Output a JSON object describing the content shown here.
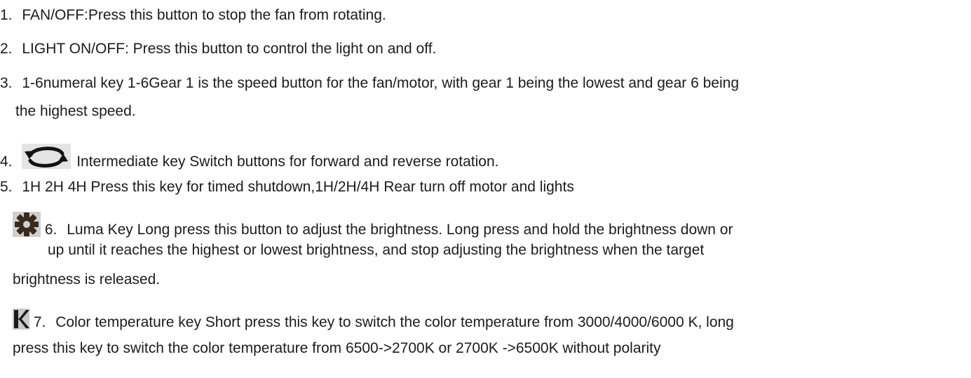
{
  "items": [
    {
      "number": "1.",
      "text": "FAN/OFF:Press this button to stop the fan from rotating."
    },
    {
      "number": "2.",
      "text": "LIGHT ON/OFF: Press this button to control the light on and off."
    },
    {
      "number": "3.",
      "text": "1-6numeral key 1-6Gear 1 is the speed button for the fan/motor, with gear 1 being the lowest and gear 6 being",
      "continuation": "the highest speed."
    },
    {
      "number": "4.",
      "icon": "rotate-arrows-icon",
      "text": "Intermediate key Switch buttons for forward and reverse rotation."
    },
    {
      "number": "5.",
      "text": "1H 2H 4H Press this key for timed shutdown,1H/2H/4H Rear turn off motor and lights"
    },
    {
      "number": "6.",
      "icon": "gear-icon",
      "text": "Luma Key Long press this button to adjust the brightness. Long press and hold the brightness down or",
      "continuation": "up until it reaches the highest or lowest brightness, and stop adjusting the brightness when the target",
      "continuation2": "brightness is released."
    },
    {
      "number": "7.",
      "icon": "k-letter-icon",
      "text": "Color temperature key Short press this key to switch the color temperature from 3000/4000/6000 K, long",
      "continuation": "press this key to switch the color temperature from 6500->2700K or 2700K ->6500K without polarity"
    }
  ]
}
